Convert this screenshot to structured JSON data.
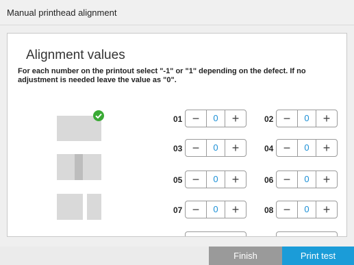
{
  "header": {
    "title": "Manual printhead alignment"
  },
  "panel": {
    "title": "Alignment values",
    "instructions": "For each number on the printout select \"-1\" or \"1\" depending on the defect. If no adjustment is needed leave the value as \"0\"."
  },
  "steppers": [
    {
      "label": "01",
      "value": "0",
      "minus": "−",
      "plus": "+"
    },
    {
      "label": "02",
      "value": "0",
      "minus": "−",
      "plus": "+"
    },
    {
      "label": "03",
      "value": "0",
      "minus": "−",
      "plus": "+"
    },
    {
      "label": "04",
      "value": "0",
      "minus": "−",
      "plus": "+"
    },
    {
      "label": "05",
      "value": "0",
      "minus": "−",
      "plus": "+"
    },
    {
      "label": "06",
      "value": "0",
      "minus": "−",
      "plus": "+"
    },
    {
      "label": "07",
      "value": "0",
      "minus": "−",
      "plus": "+"
    },
    {
      "label": "08",
      "value": "0",
      "minus": "−",
      "plus": "+"
    }
  ],
  "footer": {
    "finish_label": "Finish",
    "print_test_label": "Print test"
  },
  "colors": {
    "accent": "#1b9cd8",
    "check": "#3aaa35",
    "finish_bg": "#9a9a9a",
    "value_text": "#1a8fd6"
  },
  "icons": {
    "check": "check-circle-icon"
  }
}
